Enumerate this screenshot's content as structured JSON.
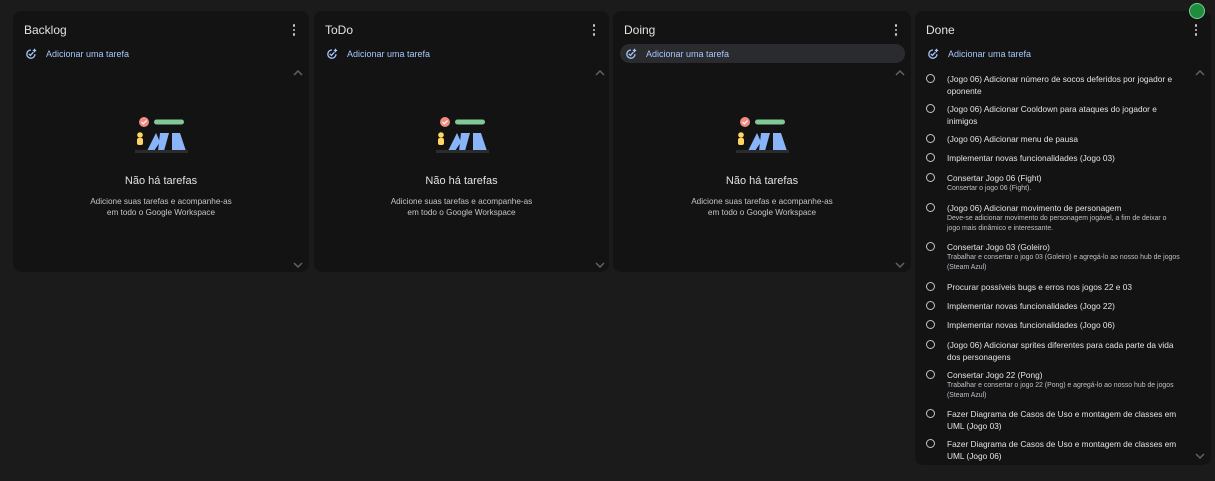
{
  "columns": [
    {
      "title": "Backlog",
      "add_label": "Adicionar uma tarefa",
      "empty_title": "Não há tarefas",
      "empty_sub": "Adicione suas tarefas e acompanhe-as em todo o Google Workspace"
    },
    {
      "title": "ToDo",
      "add_label": "Adicionar uma tarefa",
      "empty_title": "Não há tarefas",
      "empty_sub": "Adicione suas tarefas e acompanhe-as em todo o Google Workspace"
    },
    {
      "title": "Doing",
      "add_label": "Adicionar uma tarefa",
      "empty_title": "Não há tarefas",
      "empty_sub": "Adicione suas tarefas e acompanhe-as em todo o Google Workspace"
    },
    {
      "title": "Done",
      "add_label": "Adicionar uma tarefa"
    }
  ],
  "done_tasks": [
    {
      "title": "(Jogo 06) Adicionar número de socos deferidos por jogador e oponente",
      "desc": ""
    },
    {
      "title": "(Jogo 06) Adicionar Cooldown para ataques do jogador e inimigos",
      "desc": ""
    },
    {
      "title": "(Jogo 06) Adicionar menu de pausa",
      "desc": ""
    },
    {
      "title": "Implementar novas funcionalidades (Jogo 03)",
      "desc": ""
    },
    {
      "title": "Consertar Jogo 06 (Fight)",
      "desc": "Consertar o jogo 06 (Fight)."
    },
    {
      "title": "(Jogo 06) Adicionar movimento de personagem",
      "desc": "Deve-se adicionar movimento do personagem jogável, a fim de deixar o jogo mais dinâmico e interessante."
    },
    {
      "title": "Consertar Jogo 03 (Goleiro)",
      "desc": "Trabalhar e consertar o jogo 03 (Goleiro) e agregá-lo ao nosso hub de jogos (Steam Azul)"
    },
    {
      "title": "Procurar possíveis bugs e erros nos jogos 22 e 03",
      "desc": ""
    },
    {
      "title": "Implementar novas funcionalidades (Jogo 22)",
      "desc": ""
    },
    {
      "title": "Implementar novas funcionalidades (Jogo 06)",
      "desc": ""
    },
    {
      "title": "(Jogo 06) Adicionar sprites diferentes para cada parte da vida dos personagens",
      "desc": ""
    },
    {
      "title": "Consertar Jogo 22 (Pong)",
      "desc": "Trabalhar e consertar o jogo 22 (Pong) e agregá-lo ao nosso hub de jogos (Steam Azul)"
    },
    {
      "title": "Fazer Diagrama de Casos de Uso e montagem de classes em UML (Jogo 03)",
      "desc": ""
    },
    {
      "title": "Fazer Diagrama de Casos de Uso e montagem de classes em UML (Jogo 06)",
      "desc": ""
    }
  ],
  "icons": {
    "add": "add-task-icon",
    "more": "more-vert-icon",
    "chevron_up": "chevron-up-icon",
    "chevron_down": "chevron-down-icon",
    "circle": "checkbox-circle-icon",
    "illustration": "empty-tasks-illustration"
  },
  "colors": {
    "background": "#1b1b1b",
    "panel": "#131314",
    "accent": "#a8c7fa",
    "text": "#e3e3e3"
  }
}
